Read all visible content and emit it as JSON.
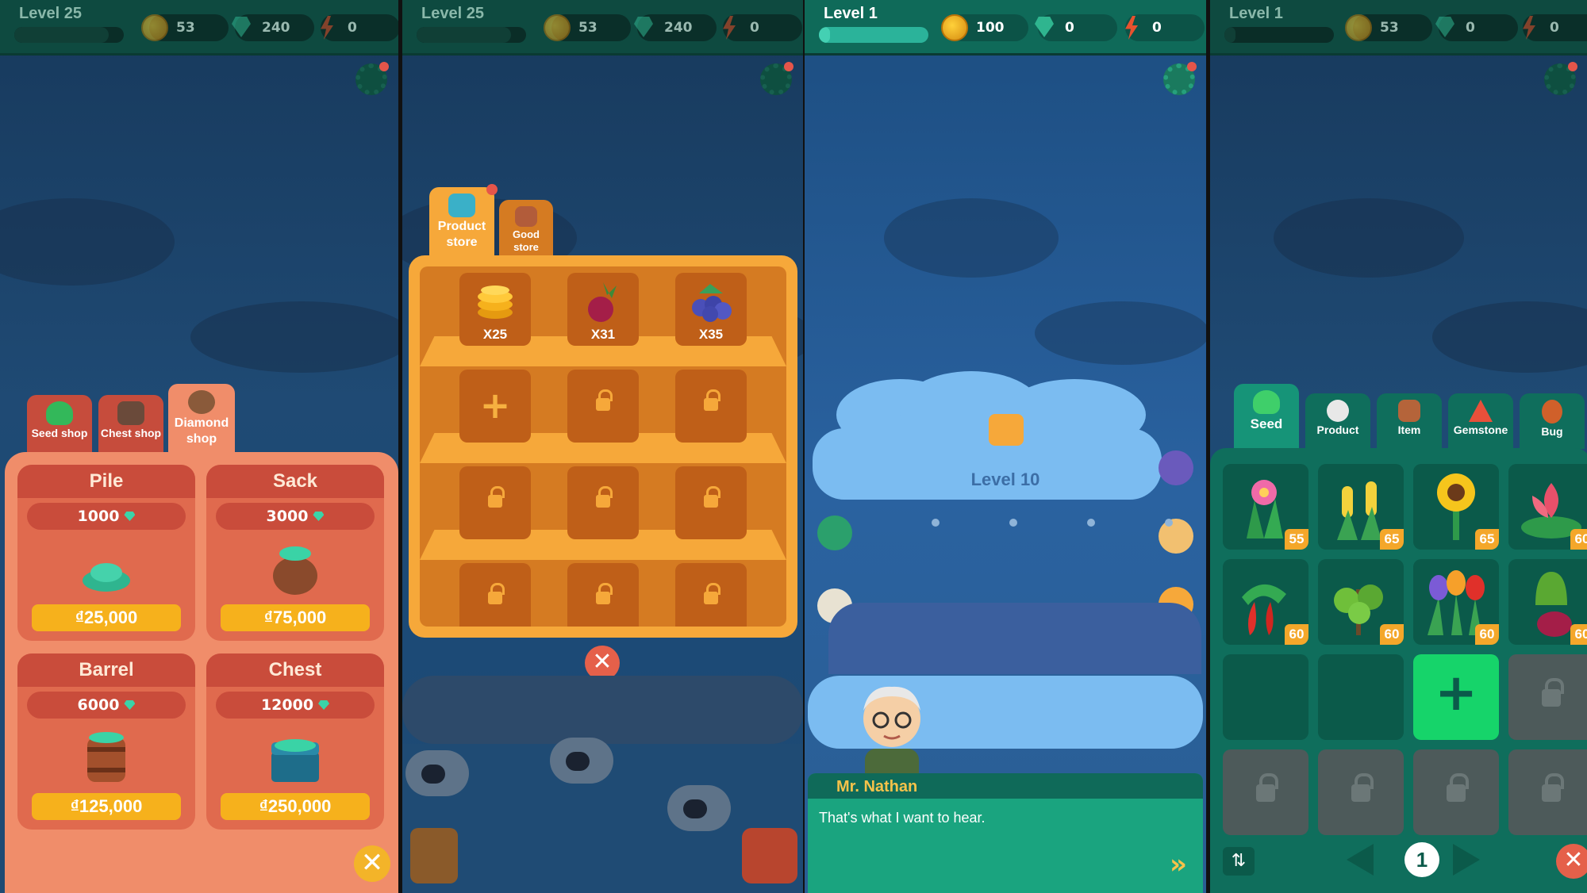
{
  "panels": {
    "p1": {
      "hud": {
        "level": "Level 25",
        "coins": "53",
        "gems": "240",
        "energy": "0"
      },
      "tabs": [
        "Seed shop",
        "Chest shop",
        "Diamond shop"
      ],
      "packs": [
        {
          "name": "Pile",
          "amount": "1000",
          "price": "₫25,000"
        },
        {
          "name": "Sack",
          "amount": "3000",
          "price": "₫75,000"
        },
        {
          "name": "Barrel",
          "amount": "6000",
          "price": "₫125,000"
        },
        {
          "name": "Chest",
          "amount": "12000",
          "price": "₫250,000"
        }
      ]
    },
    "p2": {
      "hud": {
        "level": "Level 25",
        "coins": "53",
        "gems": "240",
        "energy": "0"
      },
      "tabs": [
        "Product store",
        "Good store"
      ],
      "items": [
        "X25",
        "X31",
        "X35"
      ]
    },
    "p3": {
      "hud": {
        "level": "Level 1",
        "coins": "100",
        "gems": "0",
        "energy": "0"
      },
      "cloud_level": "Level 10",
      "speaker": "Mr. Nathan",
      "line": "That's what I want to hear."
    },
    "p4": {
      "hud": {
        "level": "Level 1",
        "coins": "53",
        "gems": "0",
        "energy": "0"
      },
      "tabs": [
        "Seed",
        "Product",
        "Item",
        "Gemstone",
        "Bug"
      ],
      "counts": [
        "55",
        "65",
        "65",
        "60",
        "60",
        "60",
        "60",
        "60"
      ],
      "page": "1"
    }
  },
  "colors": {
    "hud_bg": "#0e4a40",
    "coin": "#f6b11c",
    "gem": "#2fb58f",
    "energy": "#e8522e",
    "diamond_shop_bg": "#f08d6a",
    "product_store_bg": "#f6a83a",
    "inventory_bg": "#0f6e5c"
  }
}
